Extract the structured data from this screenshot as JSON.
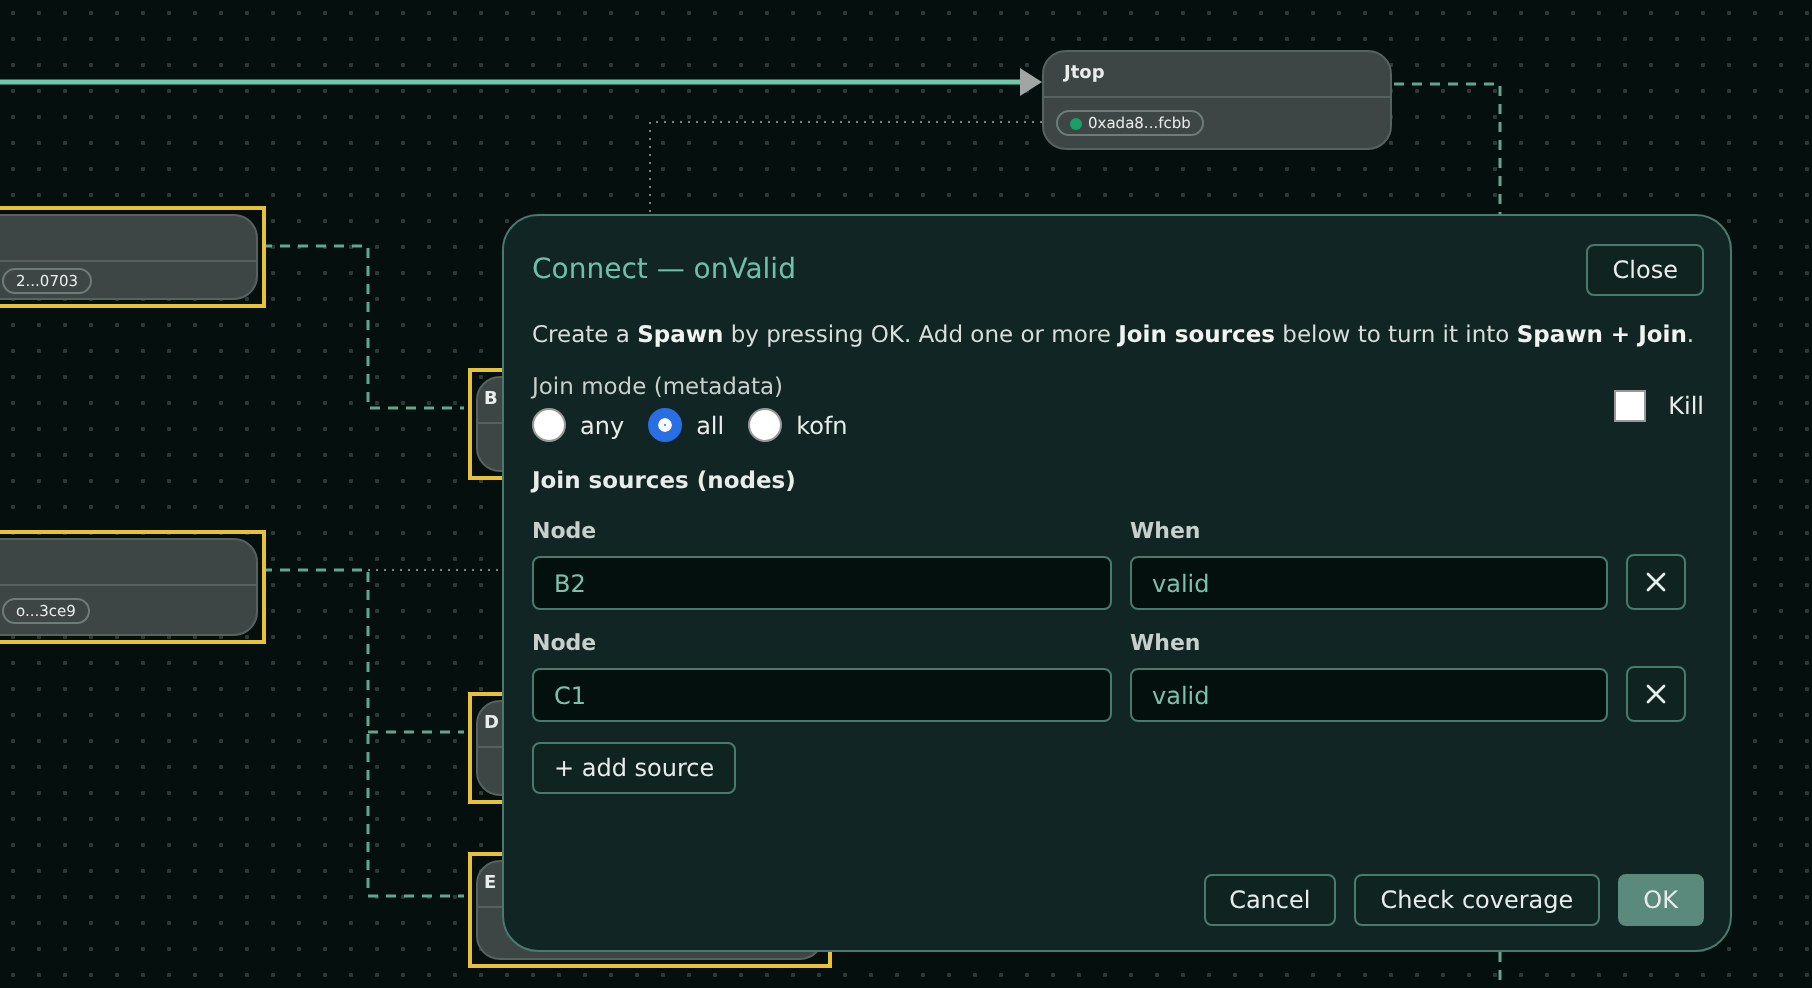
{
  "canvas": {
    "nodes": [
      {
        "title": "Jtop",
        "chip": "0xada8...fcbb",
        "highlighted": false
      },
      {
        "chip": "2...0703",
        "highlighted": true
      },
      {
        "chip": "o...3ce9",
        "highlighted": true
      },
      {
        "title": "B",
        "highlighted": true
      },
      {
        "title": "D",
        "highlighted": true
      },
      {
        "title": "E",
        "highlighted": true
      }
    ]
  },
  "dialog": {
    "title": "Connect — onValid",
    "close": "Close",
    "description": "Create a **Spawn** by pressing OK. Add one or more **Join sources** below to turn it into **Spawn + Join**.",
    "join_mode": {
      "label": "Join mode (metadata)",
      "options": [
        {
          "label": "any",
          "selected": false
        },
        {
          "label": "all",
          "selected": true
        },
        {
          "label": "kofn",
          "selected": false
        }
      ]
    },
    "kill": {
      "label": "Kill",
      "checked": false
    },
    "sources_heading": "Join sources (nodes)",
    "sources": [
      {
        "node_label": "Node",
        "node": "B2",
        "when_label": "When",
        "when": "valid"
      },
      {
        "node_label": "Node",
        "node": "C1",
        "when_label": "When",
        "when": "valid"
      }
    ],
    "add_source": "+ add source",
    "buttons": [
      {
        "label": "Cancel",
        "kind": "secondary"
      },
      {
        "label": "Check coverage",
        "kind": "secondary"
      },
      {
        "label": "OK",
        "kind": "primary"
      }
    ]
  }
}
